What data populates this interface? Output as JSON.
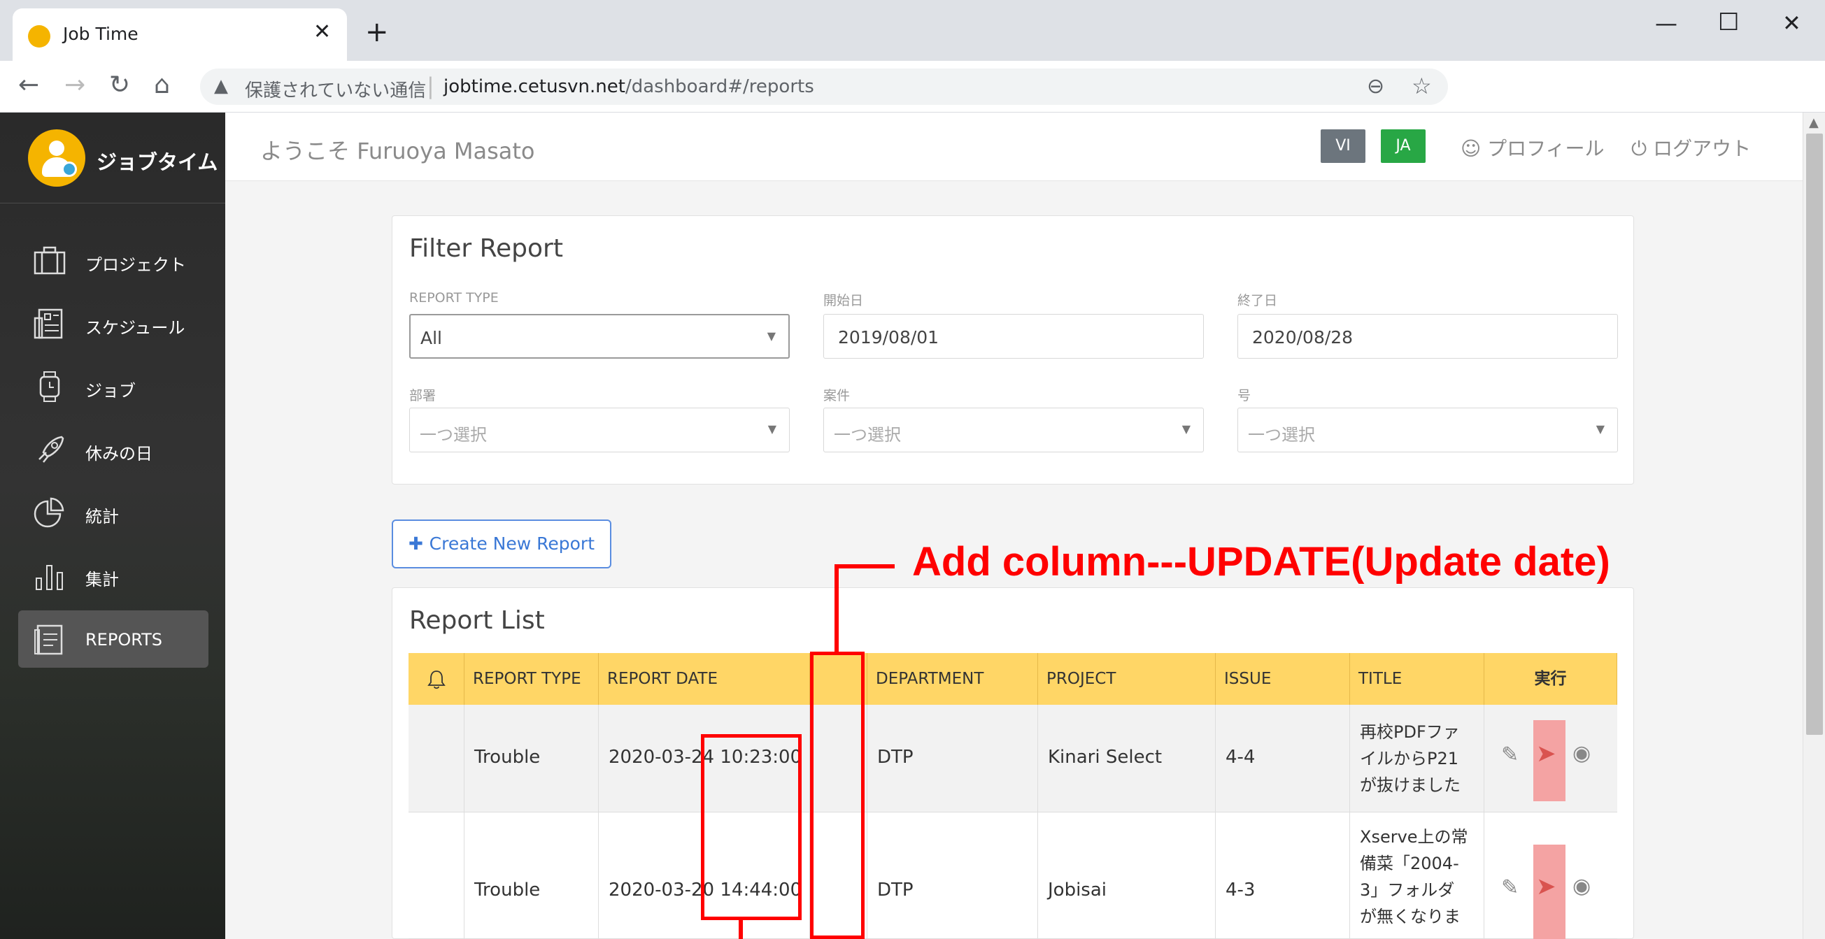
{
  "browser": {
    "tab_title": "Job Time",
    "new_tab": "+",
    "security_label": "保護されていない通信",
    "url_host": "jobtime.cetusvn.net",
    "url_path": "/dashboard#/reports",
    "icons": [
      "back-icon",
      "forward-icon",
      "reload-icon",
      "home-icon",
      "zoom-icon",
      "star-icon",
      "minimize-icon",
      "maximize-icon",
      "close-icon"
    ]
  },
  "sidebar": {
    "brand": "ジョブタイム",
    "items": [
      {
        "label": "プロジェクト",
        "icon": "briefcase-icon"
      },
      {
        "label": "スケジュール",
        "icon": "schedule-icon"
      },
      {
        "label": "ジョブ",
        "icon": "watch-icon"
      },
      {
        "label": "休みの日",
        "icon": "rocket-icon"
      },
      {
        "label": "統計",
        "icon": "pie-chart-icon"
      },
      {
        "label": "集計",
        "icon": "bar-chart-icon"
      },
      {
        "label": "REPORTS",
        "icon": "report-icon",
        "active": true
      }
    ]
  },
  "header": {
    "welcome": "ようこそ Furuoya Masato",
    "lang_vi": "VI",
    "lang_ja": "JA",
    "profile": "プロフィール",
    "logout": "ログアウト"
  },
  "filter": {
    "title": "Filter Report",
    "report_type_label": "REPORT TYPE",
    "report_type_value": "All",
    "start_label": "開始日",
    "start_value": "2019/08/01",
    "end_label": "終了日",
    "end_value": "2020/08/28",
    "dept_label": "部署",
    "dept_placeholder": "一つ選択",
    "case_label": "案件",
    "case_placeholder": "一つ選択",
    "issue_label": "号",
    "issue_placeholder": "一つ選択"
  },
  "create_button": "Create New Report",
  "annotation": "Add column---UPDATE(Update date)",
  "report_list": {
    "title": "Report List",
    "columns": [
      "",
      "REPORT TYPE",
      "REPORT DATE",
      "",
      "DEPARTMENT",
      "PROJECT",
      "ISSUE",
      "TITLE",
      "実行"
    ],
    "rows": [
      {
        "type": "Trouble",
        "date": "2020-03-24 10:23:00",
        "department": "DTP",
        "project": "Kinari Select",
        "issue": "4-4",
        "title_lines": [
          "再校PDFファ",
          "イルからP21",
          "が抜けました"
        ]
      },
      {
        "type": "Trouble",
        "date": "2020-03-20 14:44:00",
        "department": "DTP",
        "project": "Jobisai",
        "issue": "4-3",
        "title_lines": [
          "Xserve上の常",
          "備菜「2004-",
          "3」フォルダ",
          "が無くなりま"
        ]
      }
    ]
  }
}
